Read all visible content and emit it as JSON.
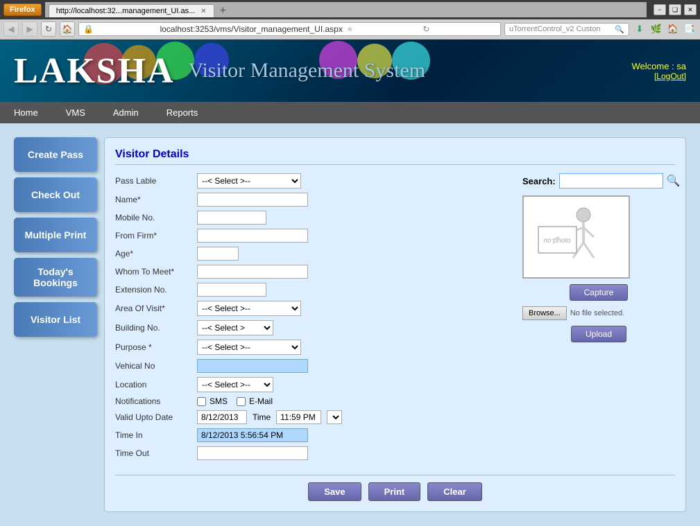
{
  "browser": {
    "firefox_label": "Firefox",
    "tab_label": "http://localhost:32...management_UI.as...",
    "address": "localhost:3253/vms/Visitor_management_UI.aspx",
    "search_placeholder": "uTorrentControl_v2 Custon"
  },
  "header": {
    "title_left": "LAKSHA",
    "title_right": "Visitor Management System",
    "welcome": "Welcome :  sa",
    "logout": "[LogOut]"
  },
  "nav_menu": {
    "items": [
      "Home",
      "VMS",
      "Admin",
      "Reports"
    ]
  },
  "sidebar": {
    "buttons": [
      "Create Pass",
      "Check Out",
      "Multiple Print",
      "Today's Bookings",
      "Visitor List"
    ]
  },
  "form": {
    "title": "Visitor Details",
    "fields": {
      "pass_label": "Pass Lable",
      "name_label": "Name*",
      "mobile_label": "Mobile No.",
      "from_firm_label": "From Firm*",
      "age_label": "Age*",
      "whom_to_meet_label": "Whom To Meet*",
      "extension_label": "Extension No.",
      "area_of_visit_label": "Area Of Visit*",
      "building_no_label": "Building No.",
      "purpose_label": "Purpose *",
      "vehical_no_label": "Vehical No",
      "location_label": "Location",
      "notifications_label": "Notifications",
      "valid_upto_label": "Valid Upto Date",
      "time_in_label": "Time In",
      "time_out_label": "Time Out"
    },
    "values": {
      "pass_select": "--< Select >--",
      "area_select": "--< Select >--",
      "building_select": "--< Select >",
      "purpose_select": "--< Select >--",
      "location_select": "--< Select >--",
      "sms_label": "SMS",
      "email_label": "E-Mail",
      "valid_date": "8/12/2013",
      "valid_time": "11:59 PM",
      "time_in_value": "8/12/2013 5:56:54 PM",
      "time_out_value": ""
    }
  },
  "photo_area": {
    "no_photo_text": "no photo",
    "capture_btn": "Capture",
    "browse_btn": "Browse...",
    "no_file_text": "No file selected.",
    "upload_btn": "Upload"
  },
  "search": {
    "label": "Search:",
    "placeholder": ""
  },
  "action_buttons": {
    "save": "Save",
    "print": "Print",
    "clear": "Clear"
  }
}
